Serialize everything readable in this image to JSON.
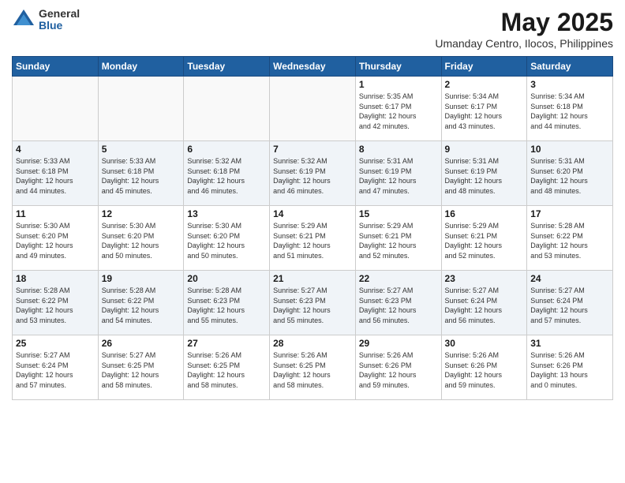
{
  "logo": {
    "general": "General",
    "blue": "Blue"
  },
  "title": "May 2025",
  "subtitle": "Umanday Centro, Ilocos, Philippines",
  "days_header": [
    "Sunday",
    "Monday",
    "Tuesday",
    "Wednesday",
    "Thursday",
    "Friday",
    "Saturday"
  ],
  "weeks": [
    [
      {
        "num": "",
        "info": ""
      },
      {
        "num": "",
        "info": ""
      },
      {
        "num": "",
        "info": ""
      },
      {
        "num": "",
        "info": ""
      },
      {
        "num": "1",
        "info": "Sunrise: 5:35 AM\nSunset: 6:17 PM\nDaylight: 12 hours\nand 42 minutes."
      },
      {
        "num": "2",
        "info": "Sunrise: 5:34 AM\nSunset: 6:17 PM\nDaylight: 12 hours\nand 43 minutes."
      },
      {
        "num": "3",
        "info": "Sunrise: 5:34 AM\nSunset: 6:18 PM\nDaylight: 12 hours\nand 44 minutes."
      }
    ],
    [
      {
        "num": "4",
        "info": "Sunrise: 5:33 AM\nSunset: 6:18 PM\nDaylight: 12 hours\nand 44 minutes."
      },
      {
        "num": "5",
        "info": "Sunrise: 5:33 AM\nSunset: 6:18 PM\nDaylight: 12 hours\nand 45 minutes."
      },
      {
        "num": "6",
        "info": "Sunrise: 5:32 AM\nSunset: 6:18 PM\nDaylight: 12 hours\nand 46 minutes."
      },
      {
        "num": "7",
        "info": "Sunrise: 5:32 AM\nSunset: 6:19 PM\nDaylight: 12 hours\nand 46 minutes."
      },
      {
        "num": "8",
        "info": "Sunrise: 5:31 AM\nSunset: 6:19 PM\nDaylight: 12 hours\nand 47 minutes."
      },
      {
        "num": "9",
        "info": "Sunrise: 5:31 AM\nSunset: 6:19 PM\nDaylight: 12 hours\nand 48 minutes."
      },
      {
        "num": "10",
        "info": "Sunrise: 5:31 AM\nSunset: 6:20 PM\nDaylight: 12 hours\nand 48 minutes."
      }
    ],
    [
      {
        "num": "11",
        "info": "Sunrise: 5:30 AM\nSunset: 6:20 PM\nDaylight: 12 hours\nand 49 minutes."
      },
      {
        "num": "12",
        "info": "Sunrise: 5:30 AM\nSunset: 6:20 PM\nDaylight: 12 hours\nand 50 minutes."
      },
      {
        "num": "13",
        "info": "Sunrise: 5:30 AM\nSunset: 6:20 PM\nDaylight: 12 hours\nand 50 minutes."
      },
      {
        "num": "14",
        "info": "Sunrise: 5:29 AM\nSunset: 6:21 PM\nDaylight: 12 hours\nand 51 minutes."
      },
      {
        "num": "15",
        "info": "Sunrise: 5:29 AM\nSunset: 6:21 PM\nDaylight: 12 hours\nand 52 minutes."
      },
      {
        "num": "16",
        "info": "Sunrise: 5:29 AM\nSunset: 6:21 PM\nDaylight: 12 hours\nand 52 minutes."
      },
      {
        "num": "17",
        "info": "Sunrise: 5:28 AM\nSunset: 6:22 PM\nDaylight: 12 hours\nand 53 minutes."
      }
    ],
    [
      {
        "num": "18",
        "info": "Sunrise: 5:28 AM\nSunset: 6:22 PM\nDaylight: 12 hours\nand 53 minutes."
      },
      {
        "num": "19",
        "info": "Sunrise: 5:28 AM\nSunset: 6:22 PM\nDaylight: 12 hours\nand 54 minutes."
      },
      {
        "num": "20",
        "info": "Sunrise: 5:28 AM\nSunset: 6:23 PM\nDaylight: 12 hours\nand 55 minutes."
      },
      {
        "num": "21",
        "info": "Sunrise: 5:27 AM\nSunset: 6:23 PM\nDaylight: 12 hours\nand 55 minutes."
      },
      {
        "num": "22",
        "info": "Sunrise: 5:27 AM\nSunset: 6:23 PM\nDaylight: 12 hours\nand 56 minutes."
      },
      {
        "num": "23",
        "info": "Sunrise: 5:27 AM\nSunset: 6:24 PM\nDaylight: 12 hours\nand 56 minutes."
      },
      {
        "num": "24",
        "info": "Sunrise: 5:27 AM\nSunset: 6:24 PM\nDaylight: 12 hours\nand 57 minutes."
      }
    ],
    [
      {
        "num": "25",
        "info": "Sunrise: 5:27 AM\nSunset: 6:24 PM\nDaylight: 12 hours\nand 57 minutes."
      },
      {
        "num": "26",
        "info": "Sunrise: 5:27 AM\nSunset: 6:25 PM\nDaylight: 12 hours\nand 58 minutes."
      },
      {
        "num": "27",
        "info": "Sunrise: 5:26 AM\nSunset: 6:25 PM\nDaylight: 12 hours\nand 58 minutes."
      },
      {
        "num": "28",
        "info": "Sunrise: 5:26 AM\nSunset: 6:25 PM\nDaylight: 12 hours\nand 58 minutes."
      },
      {
        "num": "29",
        "info": "Sunrise: 5:26 AM\nSunset: 6:26 PM\nDaylight: 12 hours\nand 59 minutes."
      },
      {
        "num": "30",
        "info": "Sunrise: 5:26 AM\nSunset: 6:26 PM\nDaylight: 12 hours\nand 59 minutes."
      },
      {
        "num": "31",
        "info": "Sunrise: 5:26 AM\nSunset: 6:26 PM\nDaylight: 13 hours\nand 0 minutes."
      }
    ]
  ]
}
